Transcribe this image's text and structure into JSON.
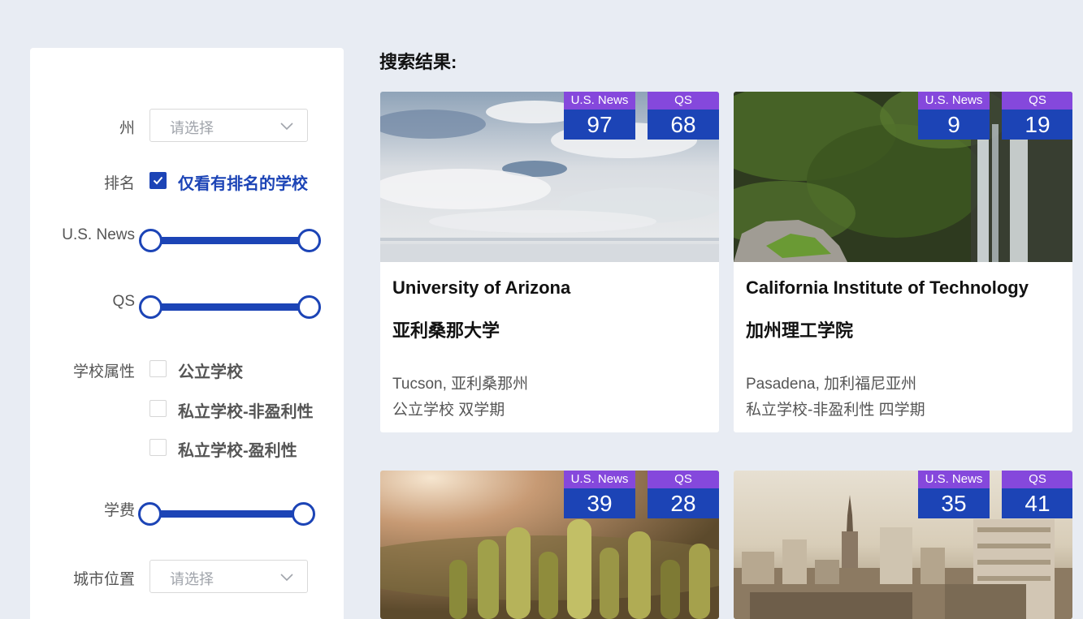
{
  "filters": {
    "state": {
      "label": "州",
      "placeholder": "请选择"
    },
    "ranking": {
      "label": "排名",
      "option": "仅看有排名的学校",
      "checked": true
    },
    "usnews": {
      "label": "U.S. News"
    },
    "qs": {
      "label": "QS"
    },
    "school_type": {
      "label": "学校属性",
      "options": [
        {
          "label": "公立学校",
          "checked": false
        },
        {
          "label": "私立学校-非盈利性",
          "checked": false
        },
        {
          "label": "私立学校-盈利性",
          "checked": false
        }
      ]
    },
    "tuition": {
      "label": "学费"
    },
    "city": {
      "label": "城市位置",
      "placeholder": "请选择"
    }
  },
  "results": {
    "title": "搜索结果:",
    "rank_labels": {
      "usnews": "U.S. News",
      "qs": "QS"
    },
    "cards": [
      {
        "name_en": "University of Arizona",
        "name_zh": "亚利桑那大学",
        "location": "Tucson, 亚利桑那州",
        "type": "公立学校 双学期",
        "usnews": "97",
        "qs": "68",
        "image": "sky-reflection-photo"
      },
      {
        "name_en": "California Institute of Technology",
        "name_zh": "加州理工学院",
        "location": "Pasadena, 加利福尼亚州",
        "type": "私立学校-非盈利性 四学期",
        "usnews": "9",
        "qs": "19",
        "image": "waterfall-photo"
      },
      {
        "name_en": "",
        "name_zh": "",
        "location": "",
        "type": "",
        "usnews": "39",
        "qs": "28",
        "image": "cactus-photo"
      },
      {
        "name_en": "",
        "name_zh": "",
        "location": "",
        "type": "",
        "usnews": "35",
        "qs": "41",
        "image": "city-skyline-photo"
      }
    ]
  },
  "colors": {
    "primary": "#1c44b6",
    "badge_label": "#8548dc",
    "background": "#e8ecf3"
  }
}
